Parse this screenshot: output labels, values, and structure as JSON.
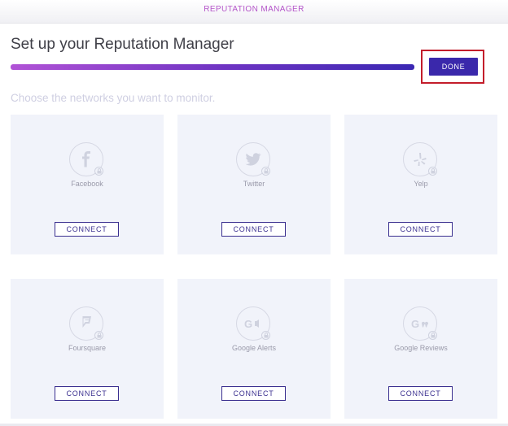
{
  "header": {
    "app_title": "REPUTATION MANAGER"
  },
  "setup": {
    "title": "Set up your Reputation Manager",
    "done_label": "DONE",
    "instruction": "Choose the networks you want to monitor."
  },
  "colors": {
    "accent": "#3a28ab",
    "progress_start": "#b153d6",
    "progress_end": "#3b28b3",
    "highlight": "#c31d2b",
    "card_bg": "#f1f3fa"
  },
  "networks": [
    {
      "name": "Facebook",
      "icon": "facebook-icon",
      "action_label": "CONNECT"
    },
    {
      "name": "Twitter",
      "icon": "twitter-icon",
      "action_label": "CONNECT"
    },
    {
      "name": "Yelp",
      "icon": "yelp-icon",
      "action_label": "CONNECT"
    },
    {
      "name": "Foursquare",
      "icon": "foursquare-icon",
      "action_label": "CONNECT"
    },
    {
      "name": "Google Alerts",
      "icon": "google-alerts-icon",
      "action_label": "CONNECT"
    },
    {
      "name": "Google Reviews",
      "icon": "google-reviews-icon",
      "action_label": "CONNECT"
    }
  ]
}
